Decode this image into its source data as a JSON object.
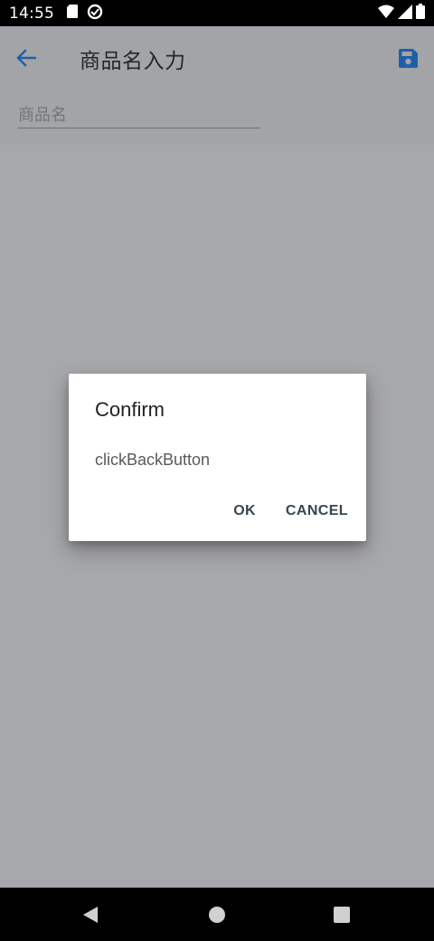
{
  "status_bar": {
    "time": "14:55",
    "left_icons": [
      "sd-card-icon",
      "data-saver-icon"
    ],
    "right_icons": [
      "wifi-icon",
      "signal-icon",
      "battery-icon"
    ]
  },
  "app_bar": {
    "title": "商品名入力",
    "back_icon": "arrow-back-icon",
    "save_icon": "save-icon",
    "accent_color": "#1565c0"
  },
  "form": {
    "product_name_value": "",
    "product_name_placeholder": "商品名"
  },
  "dialog": {
    "title": "Confirm",
    "message": "clickBackButton",
    "ok_label": "OK",
    "cancel_label": "CANCEL"
  },
  "nav_bar": {
    "icons": [
      "nav-back-icon",
      "nav-home-icon",
      "nav-recents-icon"
    ]
  }
}
